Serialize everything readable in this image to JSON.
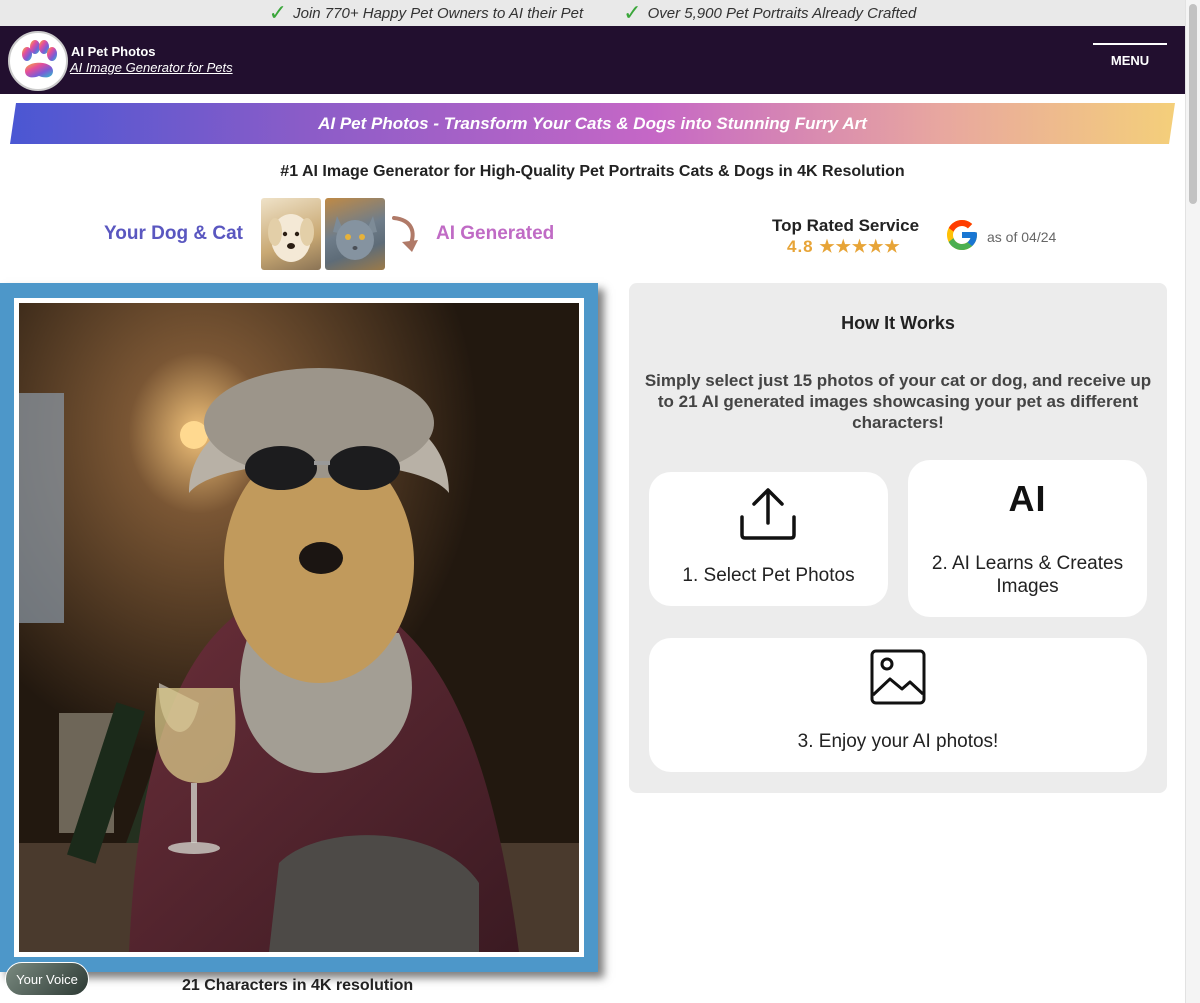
{
  "promo_bar": {
    "items": [
      {
        "icon": "checkmark-icon",
        "text": "Join 770+ Happy Pet Owners to AI their Pet"
      },
      {
        "icon": "checkmark-icon",
        "text": "Over 5,900 Pet Portraits Already Crafted"
      }
    ]
  },
  "header": {
    "logo_icon": "paw-icon",
    "brand_name": "AI Pet Photos",
    "brand_tagline": "AI Image Generator for Pets",
    "menu_label": "MENU"
  },
  "hero": {
    "banner": "AI Pet Photos - Transform Your Cats & Dogs into Stunning Furry Art",
    "subheading": "#1 AI Image Generator for High-Quality Pet Portraits Cats & Dogs in 4K Resolution",
    "before_label": "Your Dog & Cat",
    "after_label": "AI Generated"
  },
  "rating": {
    "title": "Top Rated Service",
    "score": "4.8",
    "stars": 4.8,
    "stars_text": "★★★★★",
    "provider_icon": "google-icon",
    "as_of": "as of 04/24"
  },
  "showcase": {
    "caption": "21 Characters in 4K resolution"
  },
  "voice_badge": "Your Voice",
  "how_it_works": {
    "title": "How It Works",
    "description": "Simply select just 15 photos of your cat or dog, and receive up to 21 AI generated images showcasing your pet as different characters!",
    "steps": [
      {
        "icon": "upload-icon",
        "label": "1. Select Pet Photos"
      },
      {
        "icon": "ai-icon",
        "icon_text": "AI",
        "label": "2. AI Learns & Creates Images"
      },
      {
        "icon": "image-icon",
        "label": "3. Enjoy your AI photos!"
      }
    ]
  },
  "colors": {
    "header_bg": "#220f2f",
    "card_frame": "#4d97c9",
    "rating_gold": "#e7a437",
    "before_label": "#5a57c0",
    "after_label": "#c06bc5"
  }
}
